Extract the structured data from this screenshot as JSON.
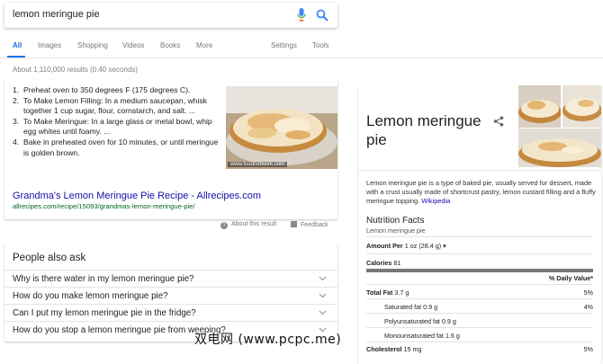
{
  "search": {
    "query": "lemon meringue pie",
    "icons": [
      "mic-icon",
      "search-icon"
    ],
    "accent": "#1a73e8"
  },
  "tabs": [
    {
      "label": "All",
      "active": true
    },
    {
      "label": "Images"
    },
    {
      "label": "Shopping"
    },
    {
      "label": "Videos"
    },
    {
      "label": "Books"
    },
    {
      "label": "More"
    },
    {
      "label": "Settings"
    },
    {
      "label": "Tools"
    }
  ],
  "result_stats": "About 1,110,000 results (0.40 seconds)",
  "snippet": {
    "steps": [
      {
        "num": "1.",
        "text": "Preheat oven to 350 degrees F (175 degrees C)."
      },
      {
        "num": "2.",
        "text": "To Make Lemon Filling: In a medium saucepan, whisk together 1 cup sugar, flour, cornstarch, and salt. ..."
      },
      {
        "num": "3.",
        "text": "To Make Meringue: In a large glass or metal bowl, whip egg whites until foamy. ..."
      },
      {
        "num": "4.",
        "text": "Bake in preheated oven for 10 minutes, or until meringue is golden brown."
      }
    ],
    "image_credit": "www.foodnetwork.com",
    "title": "Grandma's Lemon Meringue Pie Recipe - Allrecipes.com",
    "url": "allrecipes.com/recipe/15093/grandmas-lemon-meringue-pie/",
    "about": "About this result",
    "feedback": "Feedback",
    "title_color": "#1a0dab",
    "url_color": "#006621"
  },
  "people_also_ask": {
    "heading": "People also ask",
    "questions": [
      "Why is there water in my lemon meringue pie?",
      "How do you make lemon meringue pie?",
      "Can I put my lemon meringue pie in the fridge?",
      "How do you stop a lemon meringue pie from weeping?"
    ]
  },
  "knowledge_panel": {
    "title": "Lemon meringue pie",
    "description": "Lemon meringue pie is a type of baked pie, usually served for dessert, made with a crust usually made of shortcrust pastry, lemon custard filling and a fluffy meringue topping.",
    "wiki_link": "Wikipedia",
    "nutrition": {
      "heading": "Nutrition Facts",
      "subheading": "Lemon meringue pie",
      "amount_per_label": "Amount Per",
      "amount_per_value": "1 oz (28.4 g)",
      "calories_label": "Calories",
      "calories_value": "81",
      "daily_value_label": "% Daily Value*",
      "rows": [
        {
          "label": "Total Fat",
          "value": "3.7 g",
          "pct": "5%",
          "bold": true,
          "indent": false
        },
        {
          "label": "Saturated fat",
          "value": "0.9 g",
          "pct": "4%",
          "bold": false,
          "indent": true
        },
        {
          "label": "Polyunsaturated fat",
          "value": "0.9 g",
          "pct": "",
          "bold": false,
          "indent": true
        },
        {
          "label": "Monounsaturated fat",
          "value": "1.6 g",
          "pct": "",
          "bold": false,
          "indent": true
        },
        {
          "label": "Cholesterol",
          "value": "15 mg",
          "pct": "5%",
          "bold": true,
          "indent": false
        }
      ]
    }
  },
  "watermark": "双电网 (www.pcpc.me)"
}
